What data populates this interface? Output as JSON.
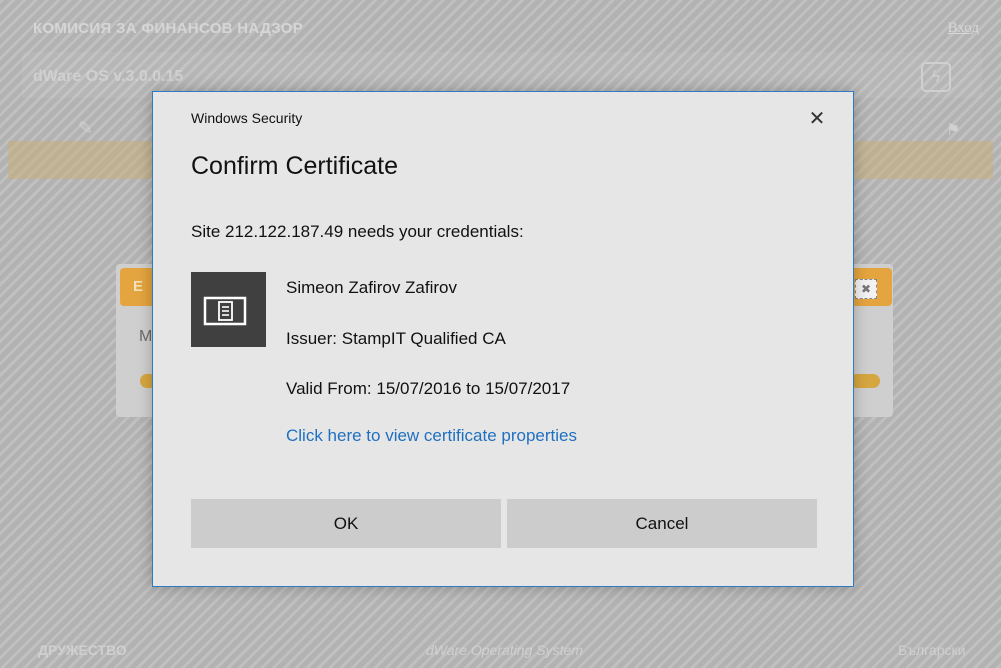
{
  "background": {
    "org_name": "КОМИСИЯ ЗА ФИНАНСОВ НАДЗОР",
    "login_link": "Вход",
    "version": "dWare OS v.3.0.0.15",
    "panel_letter_left": "E",
    "panel_text": "M",
    "footer_left": "ДРУЖЕСТВО",
    "footer_center": "dWare Operating System",
    "footer_right": "Български"
  },
  "dialog": {
    "caption": "Windows Security",
    "close_glyph": "✕",
    "title": "Confirm Certificate",
    "prompt": "Site 212.122.187.49 needs your credentials:",
    "certificate": {
      "name": "Simeon Zafirov Zafirov",
      "issuer": "Issuer: StampIT Qualified CA",
      "valid": "Valid From: 15/07/2016 to 15/07/2017",
      "properties_link": "Click here to view certificate properties",
      "icon": "certificate-card-icon"
    },
    "ok_label": "OK",
    "cancel_label": "Cancel"
  },
  "colors": {
    "dialog_border": "#2e7bc4",
    "link": "#1f70c1",
    "button_bg": "#cccccc",
    "icon_bg": "#404040",
    "accent_orange": "#e4a43f"
  }
}
